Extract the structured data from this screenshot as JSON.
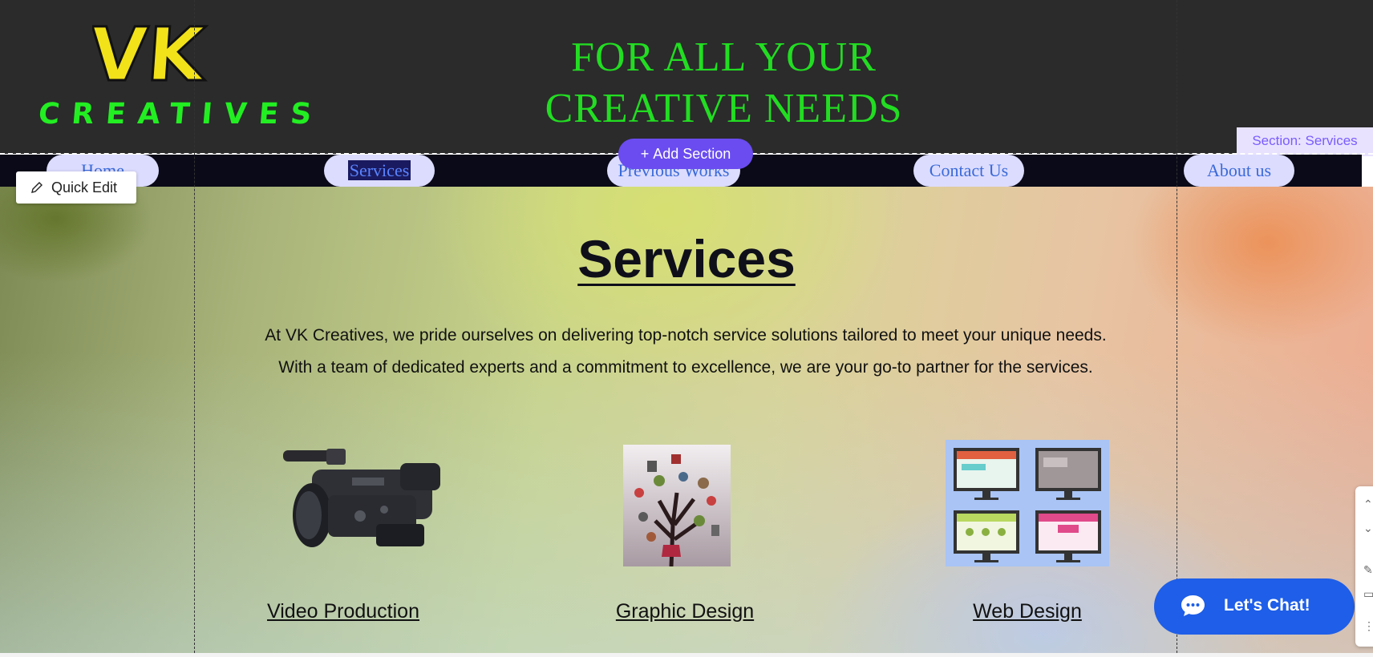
{
  "header": {
    "logo_line1": "VK",
    "logo_line2": "CREATIVES",
    "tagline_line1": "FOR ALL YOUR",
    "tagline_line2": "CREATIVE NEEDS"
  },
  "editor": {
    "section_label": "Section: Services",
    "add_section": "Add Section",
    "quick_edit": "Quick Edit"
  },
  "nav": {
    "items": [
      {
        "label": "Home"
      },
      {
        "label": "Services"
      },
      {
        "label": "Previous Works"
      },
      {
        "label": "Contact Us"
      },
      {
        "label": "About us"
      }
    ]
  },
  "main": {
    "title": "Services",
    "intro": "At VK Creatives, we pride ourselves on delivering top-notch service solutions tailored to meet your unique needs. With a team of dedicated experts and a commitment to excellence, we are your go-to partner for the services.",
    "services": [
      {
        "label": "Video Production",
        "image": "video-camera"
      },
      {
        "label": "Graphic Design",
        "image": "icon-tree"
      },
      {
        "label": "Web Design",
        "image": "web-layouts"
      }
    ]
  },
  "chat": {
    "label": "Let's Chat!"
  },
  "colors": {
    "logo_yellow": "#f2e21a",
    "logo_green": "#22ee22",
    "tagline_green": "#22dd22",
    "nav_pill": "#dcdcff",
    "nav_text": "#3a6ad8",
    "editor_purple": "#6a4cf0",
    "chat_blue": "#1e5ee8"
  }
}
